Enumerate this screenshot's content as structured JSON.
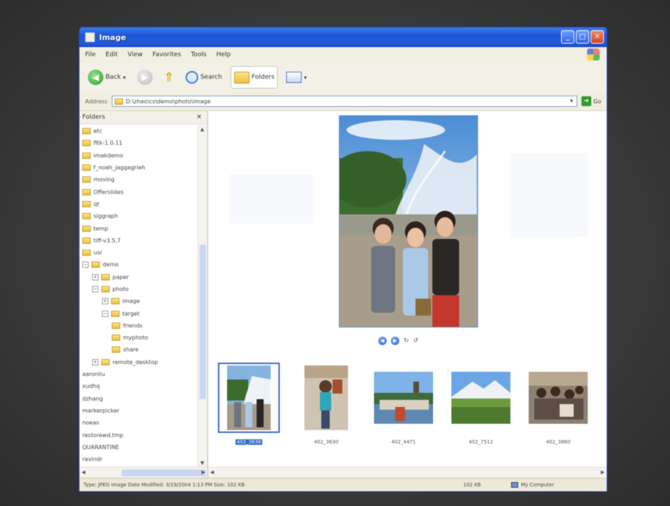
{
  "window": {
    "title": "Image"
  },
  "menu": [
    "File",
    "Edit",
    "View",
    "Favorites",
    "Tools",
    "Help"
  ],
  "toolbar": {
    "back_label": "Back",
    "search_label": "Search",
    "folders_label": "Folders"
  },
  "address": {
    "label": "Address",
    "path": "D:\\zhao\\cs\\demo\\photo\\image",
    "go_label": "Go"
  },
  "folders_pane": {
    "title": "Folders",
    "items": [
      {
        "label": "etc",
        "depth": 0,
        "type": "folder"
      },
      {
        "label": "fltk-1.0.11",
        "depth": 0,
        "type": "folder"
      },
      {
        "label": "imakdemo",
        "depth": 0,
        "type": "folder"
      },
      {
        "label": "f_noah_jaggagrieh",
        "depth": 0,
        "type": "folder"
      },
      {
        "label": "moving",
        "depth": 0,
        "type": "folder"
      },
      {
        "label": "Offerslides",
        "depth": 0,
        "type": "folder"
      },
      {
        "label": "qt",
        "depth": 0,
        "type": "folder"
      },
      {
        "label": "siggraph",
        "depth": 0,
        "type": "folder"
      },
      {
        "label": "temp",
        "depth": 0,
        "type": "folder"
      },
      {
        "label": "tiff-v3.5.7",
        "depth": 0,
        "type": "folder"
      },
      {
        "label": "usr",
        "depth": 0,
        "type": "folder"
      },
      {
        "label": "demo",
        "depth": 0,
        "type": "folder",
        "expander": "−"
      },
      {
        "label": "paper",
        "depth": 1,
        "type": "folder",
        "expander": "+"
      },
      {
        "label": "photo",
        "depth": 1,
        "type": "folder",
        "expander": "−"
      },
      {
        "label": "image",
        "depth": 2,
        "type": "folder",
        "expander": "+"
      },
      {
        "label": "target",
        "depth": 2,
        "type": "folder",
        "expander": "−"
      },
      {
        "label": "friends",
        "depth": 3,
        "type": "folder"
      },
      {
        "label": "myphoto",
        "depth": 3,
        "type": "folder"
      },
      {
        "label": "share",
        "depth": 3,
        "type": "folder"
      },
      {
        "label": "remote_desktop",
        "depth": 1,
        "type": "folder",
        "expander": "+"
      },
      {
        "label": "aaronliu",
        "depth": 0,
        "type": "text"
      },
      {
        "label": "xudhq",
        "depth": 0,
        "type": "text"
      },
      {
        "label": "dzhang",
        "depth": 0,
        "type": "text"
      },
      {
        "label": "markerpicker",
        "depth": 0,
        "type": "text"
      },
      {
        "label": "noeas",
        "depth": 0,
        "type": "text"
      },
      {
        "label": "restorewd.tmp",
        "depth": 0,
        "type": "text"
      },
      {
        "label": "QUARANTINE",
        "depth": 0,
        "type": "text"
      },
      {
        "label": "ravindr",
        "depth": 0,
        "type": "text"
      }
    ]
  },
  "thumbnails": [
    {
      "label": "402_3638",
      "selected": true
    },
    {
      "label": "402_3630",
      "selected": false
    },
    {
      "label": "402_4471",
      "selected": false
    },
    {
      "label": "402_7512",
      "selected": false
    },
    {
      "label": "402_3860",
      "selected": false
    }
  ],
  "status": {
    "details": "Type: JPEG Image Date Modified: 3/19/2004 1:13 PM Size: 102 KB",
    "size": "102 KB",
    "zone": "My Computer"
  },
  "colors": {
    "titlebar": "#2259da",
    "selection": "#316ac5",
    "chrome": "#ece9d8"
  }
}
